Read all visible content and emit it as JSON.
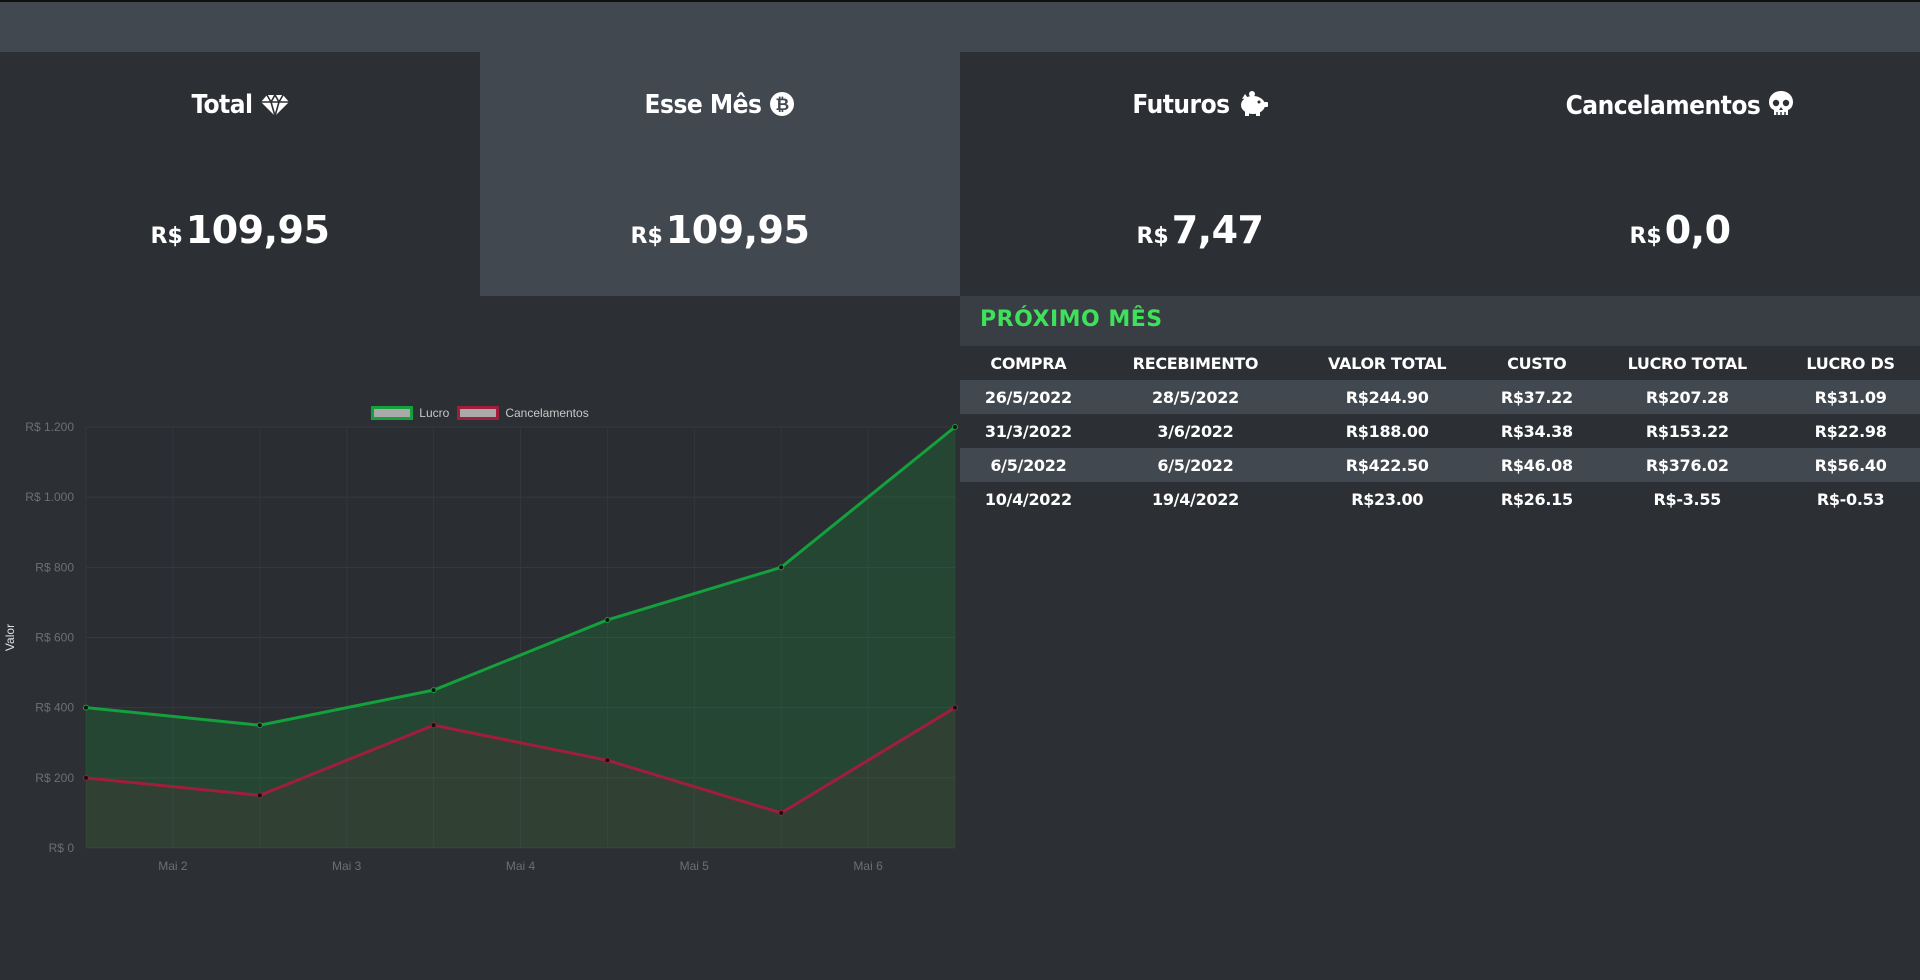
{
  "cards": [
    {
      "title": "Total",
      "icon": "diamond-icon",
      "currency": "R$",
      "value": "109,95"
    },
    {
      "title": "Esse Mês",
      "icon": "bitcoin-icon",
      "currency": "R$",
      "value": "109,95"
    },
    {
      "title": "Futuros",
      "icon": "piggy-bank-icon",
      "currency": "R$",
      "value": "7,47"
    },
    {
      "title": "Cancelamentos",
      "icon": "skull-icon",
      "currency": "R$",
      "value": "0,0"
    }
  ],
  "next_month": {
    "title": "PRÓXIMO MÊS",
    "columns": [
      "COMPRA",
      "RECEBIMENTO",
      "VALOR TOTAL",
      "CUSTO",
      "LUCRO TOTAL",
      "LUCRO DS"
    ],
    "rows": [
      [
        "26/5/2022",
        "28/5/2022",
        "R$244.90",
        "R$37.22",
        "R$207.28",
        "R$31.09"
      ],
      [
        "31/3/2022",
        "3/6/2022",
        "R$188.00",
        "R$34.38",
        "R$153.22",
        "R$22.98"
      ],
      [
        "6/5/2022",
        "6/5/2022",
        "R$422.50",
        "R$46.08",
        "R$376.02",
        "R$56.40"
      ],
      [
        "10/4/2022",
        "19/4/2022",
        "R$23.00",
        "R$26.15",
        "R$-3.55",
        "R$-0.53"
      ]
    ]
  },
  "colors": {
    "accent_green": "#3fe05a",
    "lucro": "#14a03c",
    "cancelamentos": "#a01e3c"
  },
  "chart_data": {
    "type": "area",
    "x": [
      "",
      "Mai 2",
      "",
      "Mai 3",
      "",
      "Mai 4",
      "",
      "Mai 5",
      "",
      "Mai 6",
      ""
    ],
    "series": [
      {
        "name": "Lucro",
        "values": [
          400,
          null,
          350,
          null,
          450,
          null,
          650,
          null,
          800,
          null,
          1200
        ]
      },
      {
        "name": "Cancelamentos",
        "values": [
          200,
          null,
          150,
          null,
          350,
          null,
          250,
          null,
          100,
          null,
          400
        ]
      }
    ],
    "ylabel": "Valor",
    "ylim": [
      0,
      1200
    ],
    "yticks": [
      "R$ 0",
      "R$ 200",
      "R$ 400",
      "R$ 600",
      "R$ 800",
      "R$ 1.000",
      "R$ 1.200"
    ],
    "xtick_labels": [
      "Mai 2",
      "Mai 3",
      "Mai 4",
      "Mai 5",
      "Mai 6"
    ],
    "legend": "top-center",
    "grid": true
  }
}
